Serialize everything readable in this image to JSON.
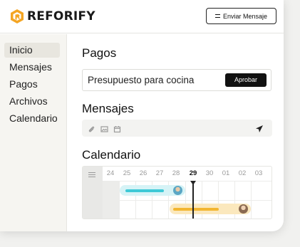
{
  "header": {
    "logo_text": "REFORIFY",
    "send_message_label": "Enviar Mensaje",
    "brand_color": "#f4a523"
  },
  "sidebar": {
    "items": [
      {
        "label": "Inicio",
        "active": true
      },
      {
        "label": "Mensajes",
        "active": false
      },
      {
        "label": "Pagos",
        "active": false
      },
      {
        "label": "Archivos",
        "active": false
      },
      {
        "label": "Calendario",
        "active": false
      }
    ]
  },
  "pagos": {
    "title": "Pagos",
    "item_text": "Presupuesto para cocina",
    "approve_label": "Aprobar"
  },
  "mensajes": {
    "title": "Mensajes",
    "toolbar_icons": [
      "paperclip-icon",
      "image-icon",
      "calendar-icon"
    ],
    "send_icon": "send-icon"
  },
  "calendario": {
    "title": "Calendario",
    "days": [
      "24",
      "25",
      "26",
      "27",
      "28",
      "29",
      "30",
      "01",
      "02",
      "03"
    ],
    "today": "29",
    "events": [
      {
        "color": "#3ec9d6",
        "bg": "#d6f3f6",
        "avatar_color": "#5aa6c4"
      },
      {
        "color": "#f2b632",
        "bg": "#fbe8bd",
        "avatar_color": "#c08a5a"
      }
    ]
  }
}
